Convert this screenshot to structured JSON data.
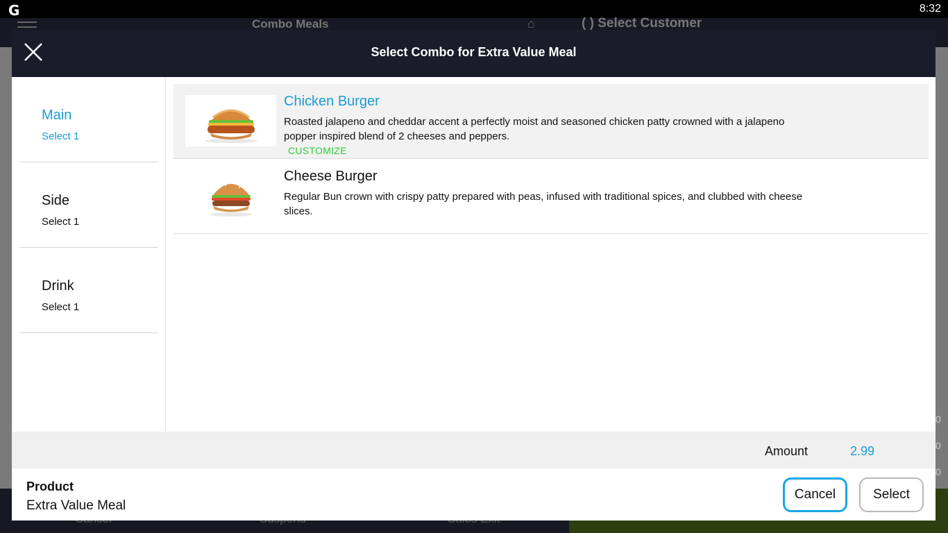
{
  "status_bar": {
    "logo": "G",
    "time": "8:32"
  },
  "background": {
    "title": "Combo Meals",
    "select_customer": "( ) Select Customer",
    "bottom_buttons": [
      "Cancel",
      "Suspend",
      "Sales Exit"
    ]
  },
  "modal": {
    "title": "Select Combo for Extra Value Meal",
    "categories": [
      {
        "name": "Main",
        "sub": "Select 1",
        "active": true
      },
      {
        "name": "Side",
        "sub": "Select 1",
        "active": false
      },
      {
        "name": "Drink",
        "sub": "Select 1",
        "active": false
      }
    ],
    "items": [
      {
        "name": "Chicken Burger",
        "description": "Roasted jalapeno and cheddar accent a perfectly moist and seasoned chicken patty crowned with a jalapeno popper inspired blend of 2 cheeses and peppers.",
        "customize": "CUSTOMIZE",
        "selected": true
      },
      {
        "name": "Cheese Burger",
        "description": "Regular Bun crown with crispy patty prepared with peas, infused with traditional spices, and clubbed with cheese slices.",
        "selected": false
      }
    ],
    "amount_label": "Amount",
    "amount_value": "2.99",
    "product_label": "Product",
    "product_value": "Extra Value Meal",
    "cancel_label": "Cancel",
    "select_label": "Select"
  },
  "colors": {
    "accent": "#1b9bd6",
    "customize": "#2ecc3a",
    "header": "#1b1c2a"
  }
}
